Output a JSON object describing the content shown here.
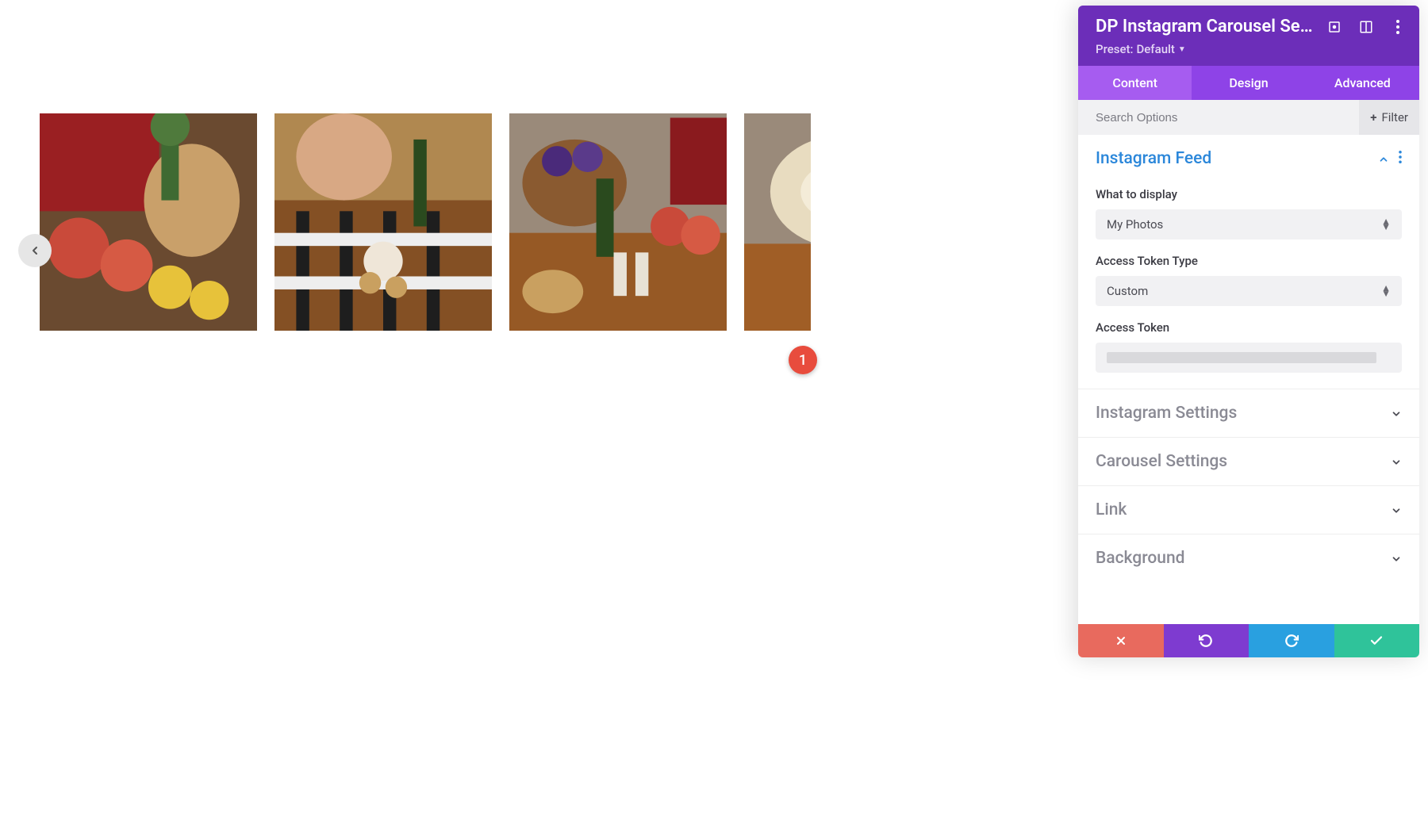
{
  "panel": {
    "title": "DP Instagram Carousel Sett...",
    "preset_label": "Preset:",
    "preset_value": "Default"
  },
  "tabs": {
    "content": "Content",
    "design": "Design",
    "advanced": "Advanced"
  },
  "search": {
    "placeholder": "Search Options",
    "filter_label": "Filter"
  },
  "sections": {
    "instagram_feed": {
      "title": "Instagram Feed",
      "what_to_display_label": "What to display",
      "what_to_display_value": "My Photos",
      "access_token_type_label": "Access Token Type",
      "access_token_type_value": "Custom",
      "access_token_label": "Access Token"
    },
    "instagram_settings": {
      "title": "Instagram Settings"
    },
    "carousel_settings": {
      "title": "Carousel Settings"
    },
    "link": {
      "title": "Link"
    },
    "background": {
      "title": "Background"
    }
  },
  "badge": {
    "one": "1"
  }
}
